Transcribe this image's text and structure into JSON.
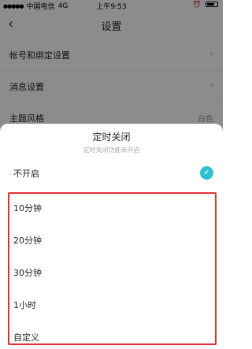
{
  "status_bar": {
    "carrier": "中国电信",
    "network": "4G",
    "time": "上午9:53"
  },
  "nav": {
    "title": "设置"
  },
  "settings": [
    {
      "label": "帐号和绑定设置",
      "value": ""
    },
    {
      "label": "消息设置",
      "value": ""
    },
    {
      "label": "主题风格",
      "value": "白色"
    }
  ],
  "sheet": {
    "title": "定时关闭",
    "subtitle": "定时关闭功能未开启",
    "options": [
      {
        "label": "不开启",
        "selected": true
      },
      {
        "label": "10分钟",
        "selected": false
      },
      {
        "label": "20分钟",
        "selected": false
      },
      {
        "label": "30分钟",
        "selected": false
      },
      {
        "label": "1小时",
        "selected": false
      },
      {
        "label": "自定义",
        "selected": false
      }
    ]
  },
  "colors": {
    "accent": "#33bfd2",
    "highlight": "#e0302f"
  }
}
